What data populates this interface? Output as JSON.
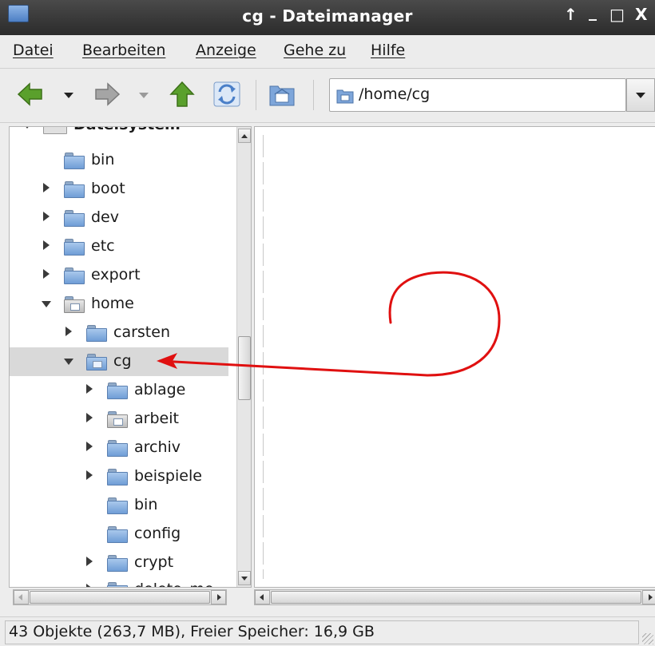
{
  "window": {
    "title": "cg - Dateimanager",
    "buttons": {
      "up": "↑",
      "minimize": "_",
      "maximize": "□",
      "close": "X"
    }
  },
  "menubar": {
    "items": [
      {
        "label": "Datei"
      },
      {
        "label": "Bearbeiten"
      },
      {
        "label": "Anzeige"
      },
      {
        "label": "Gehe zu"
      },
      {
        "label": "Hilfe"
      }
    ]
  },
  "toolbar": {
    "back_icon": "back-arrow-icon",
    "forward_icon": "forward-arrow-icon",
    "up_icon": "up-arrow-icon",
    "reload_icon": "reload-icon",
    "home_icon": "home-folder-icon",
    "location": "/home/cg",
    "colors": {
      "back": "#5aa02c",
      "forward": "#9a9a9a",
      "up": "#5aa02c",
      "reload": "#4a7fc8"
    }
  },
  "tree": {
    "items": [
      {
        "label": "Dateisystem",
        "expander": "open",
        "bold": true
      },
      {
        "label": "bin",
        "expander": "none"
      },
      {
        "label": "boot",
        "expander": "closed"
      },
      {
        "label": "dev",
        "expander": "closed"
      },
      {
        "label": "etc",
        "expander": "closed"
      },
      {
        "label": "export",
        "expander": "closed"
      },
      {
        "label": "home",
        "expander": "open"
      },
      {
        "label": "carsten",
        "expander": "closed"
      },
      {
        "label": "cg",
        "expander": "open",
        "selected": true
      },
      {
        "label": "ablage",
        "expander": "closed"
      },
      {
        "label": "arbeit",
        "expander": "closed"
      },
      {
        "label": "archiv",
        "expander": "closed"
      },
      {
        "label": "beispiele",
        "expander": "closed"
      },
      {
        "label": "bin",
        "expander": "none"
      },
      {
        "label": "config",
        "expander": "none"
      },
      {
        "label": "crypt",
        "expander": "closed"
      },
      {
        "label": "delete_me",
        "expander": "closed"
      }
    ]
  },
  "statusbar": {
    "text": "43 Objekte (263,7 MB), Freier Speicher: 16,9 GB"
  },
  "annotation": {
    "color": "#e01010"
  }
}
